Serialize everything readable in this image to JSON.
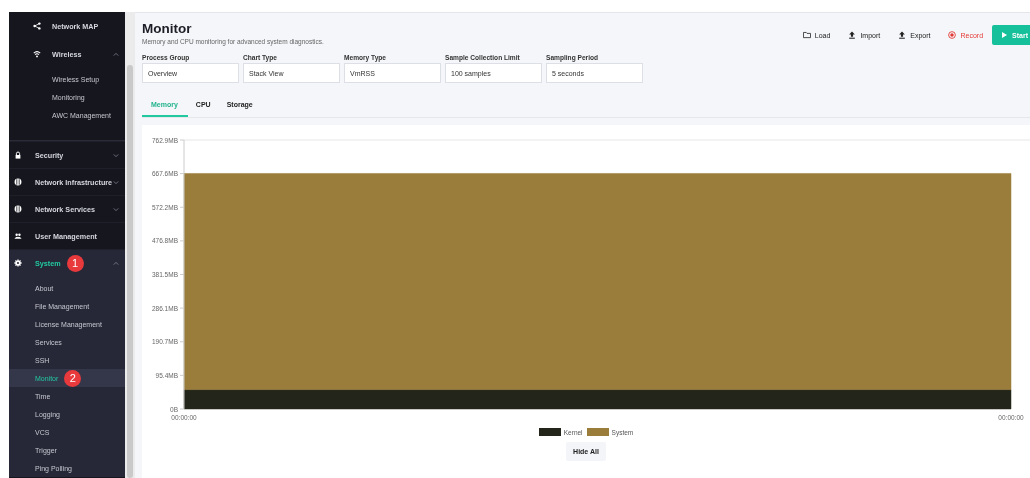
{
  "sidebar": {
    "nested_items": [
      {
        "label": "Network MAP",
        "selected": false
      },
      {
        "label": "Wireless",
        "selected": false,
        "expanded": true,
        "children": [
          {
            "label": "Wireless Setup",
            "selected": false
          },
          {
            "label": "Monitoring",
            "selected": false
          },
          {
            "label": "AWC Management",
            "selected": false
          }
        ]
      }
    ],
    "items": [
      {
        "label": "Security",
        "selected": false,
        "expanded": false
      },
      {
        "label": "Network Infrastructure",
        "selected": false,
        "expanded": false
      },
      {
        "label": "Network Services",
        "selected": false,
        "expanded": false
      },
      {
        "label": "User Management",
        "selected": false
      },
      {
        "label": "System",
        "selected": true,
        "expanded": true,
        "badge": "1",
        "children": [
          {
            "label": "About",
            "selected": false
          },
          {
            "label": "File Management",
            "selected": false
          },
          {
            "label": "License Management",
            "selected": false
          },
          {
            "label": "Services",
            "selected": false
          },
          {
            "label": "SSH",
            "selected": false
          },
          {
            "label": "Monitor",
            "selected": true,
            "badge": "2"
          },
          {
            "label": "Time",
            "selected": false
          },
          {
            "label": "Logging",
            "selected": false
          },
          {
            "label": "VCS",
            "selected": false
          },
          {
            "label": "Trigger",
            "selected": false
          },
          {
            "label": "Ping Polling",
            "selected": false
          }
        ]
      }
    ]
  },
  "header": {
    "title": "Monitor",
    "subtitle": "Memory and CPU monitoring for advanced system diagnostics.",
    "actions": [
      {
        "kind": "plain",
        "label": "Load"
      },
      {
        "kind": "plain",
        "label": "Import"
      },
      {
        "kind": "plain",
        "label": "Export"
      },
      {
        "kind": "danger",
        "label": "Record"
      },
      {
        "kind": "primary",
        "label": "Start"
      }
    ]
  },
  "fields": [
    {
      "label": "Process Group",
      "value": "Overview"
    },
    {
      "label": "Chart Type",
      "value": "Stack View"
    },
    {
      "label": "Memory Type",
      "value": "VmRSS"
    },
    {
      "label": "Sample Collection Limit",
      "value": "100 samples"
    },
    {
      "label": "Sampling Period",
      "value": "5 seconds"
    }
  ],
  "tabs": [
    {
      "label": "Memory",
      "selected": true
    },
    {
      "label": "CPU",
      "selected": false
    },
    {
      "label": "Storage",
      "selected": false
    }
  ],
  "chart": {
    "chart_data": {
      "type": "area",
      "stacked": true,
      "categories": [
        "00:00:00",
        "00:00:00"
      ],
      "ylim": [
        0,
        762.9
      ],
      "yticks": [
        {
          "value": 0,
          "label": "0B"
        },
        {
          "value": 95.4,
          "label": "95.4MB"
        },
        {
          "value": 190.7,
          "label": "190.7MB"
        },
        {
          "value": 286.1,
          "label": "286.1MB"
        },
        {
          "value": 381.5,
          "label": "381.5MB"
        },
        {
          "value": 476.8,
          "label": "476.8MB"
        },
        {
          "value": 572.2,
          "label": "572.2MB"
        },
        {
          "value": 667.6,
          "label": "667.6MB"
        },
        {
          "value": 762.9,
          "label": "762.9MB"
        }
      ],
      "series": [
        {
          "name": "Kernel",
          "color": "#24251a",
          "values": [
            55,
            55
          ]
        },
        {
          "name": "System",
          "color": "#9a7d3a",
          "values": [
            613,
            613
          ]
        }
      ]
    },
    "legend_button": "Hide All"
  }
}
